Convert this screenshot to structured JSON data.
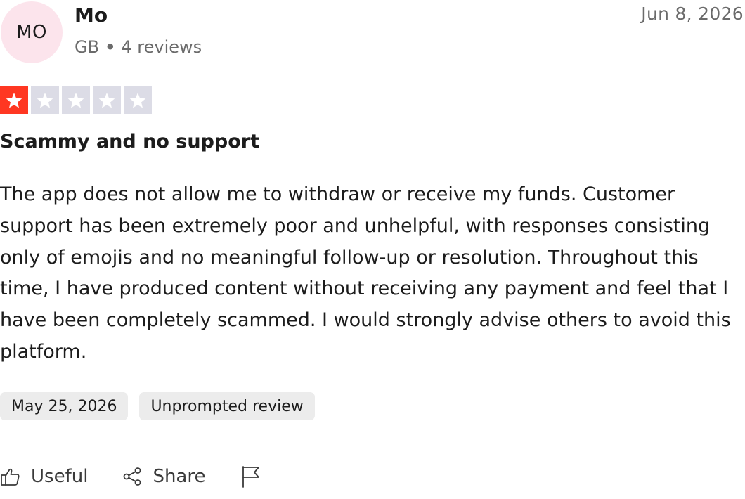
{
  "reviewer": {
    "initials": "MO",
    "name": "Mo",
    "country": "GB",
    "separator": "•",
    "review_count": "4 reviews"
  },
  "review": {
    "date": "Jun 8, 2026",
    "rating": 1,
    "rating_max": 5,
    "title": "Scammy and no support",
    "body": "The app does not allow me to withdraw or receive my funds. Customer support has been extremely poor and unhelpful, with responses consisting only of emojis and no meaningful follow-up or resolution. Throughout this time, I have produced content without receiving any payment and feel that I have been completely scammed. I would strongly advise others to avoid this platform.",
    "tags": [
      "May 25, 2026",
      "Unprompted review"
    ]
  },
  "actions": {
    "useful_label": "Useful",
    "share_label": "Share",
    "useful_icon": "thumbs-up-icon",
    "share_icon": "share-icon",
    "report_icon": "flag-icon"
  },
  "colors": {
    "star_filled": "#ff3722",
    "star_empty": "#dcdce6",
    "avatar_bg": "#fce4ec",
    "tag_bg": "#ececec"
  }
}
